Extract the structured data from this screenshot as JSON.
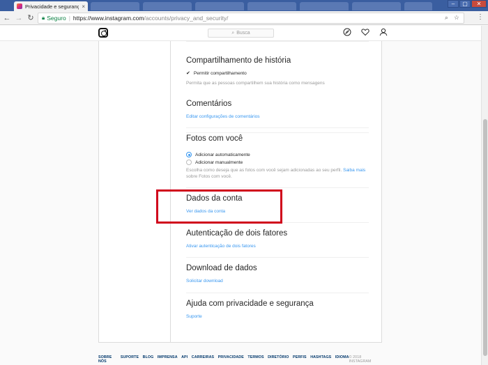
{
  "browser": {
    "tab_title": "Privacidade e segurança",
    "tab_close": "×",
    "secure_label": "Seguro",
    "url_host": "https://www.instagram.com",
    "url_path": "/accounts/privacy_and_security/"
  },
  "ig": {
    "search_placeholder": "Busca"
  },
  "sections": {
    "historia": {
      "title": "Compartilhamento de história",
      "checkbox_label": "Permitir compartilhamento",
      "description": "Permita que as pessoas compartilhem sua história como mensagens"
    },
    "comentarios": {
      "title": "Comentários",
      "link": "Editar configurações de comentários"
    },
    "fotos": {
      "title": "Fotos com você",
      "option_auto": "Adicionar automaticamente",
      "option_manual": "Adicionar manualmente",
      "desc_before": "Escolha como deseja que as fotos com você sejam adicionadas ao seu perfil.",
      "desc_link": "Saiba mais",
      "desc_after": "sobre Fotos com você."
    },
    "dados": {
      "title": "Dados da conta",
      "link": "Ver dados da conta"
    },
    "autenticacao": {
      "title": "Autenticação de dois fatores",
      "link": "Ativar autenticação de dois fatores"
    },
    "download": {
      "title": "Download de dados",
      "link": "Solicitar download"
    },
    "ajuda": {
      "title": "Ajuda com privacidade e segurança",
      "link": "Suporte"
    }
  },
  "footer": {
    "links": [
      "SOBRE NÓS",
      "SUPORTE",
      "BLOG",
      "IMPRENSA",
      "API",
      "CARREIRAS",
      "PRIVACIDADE",
      "TERMOS",
      "DIRETÓRIO",
      "PERFIS",
      "HASHTAGS",
      "IDIOMA"
    ],
    "copyright": "© 2018 INSTAGRAM"
  },
  "colors": {
    "link": "#3897f0",
    "highlight": "#d0021b",
    "tabstrip": "#3a5ea0"
  }
}
